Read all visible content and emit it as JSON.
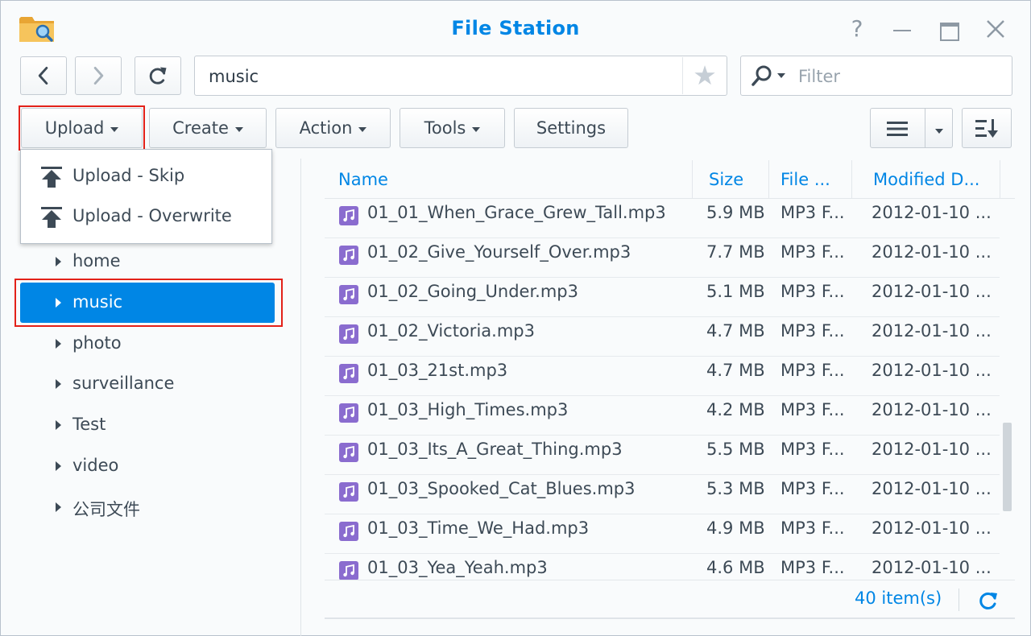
{
  "window": {
    "title": "File Station",
    "help_label": "?",
    "accent_color": "#0086e5",
    "highlight_color": "#e32119"
  },
  "navigation": {
    "path": "music",
    "filter_placeholder": "Filter"
  },
  "toolbar": {
    "upload_label": "Upload",
    "create_label": "Create",
    "action_label": "Action",
    "tools_label": "Tools",
    "settings_label": "Settings"
  },
  "upload_menu": {
    "items": [
      {
        "label": "Upload - Skip",
        "icon": "upload-icon"
      },
      {
        "label": "Upload - Overwrite",
        "icon": "upload-icon"
      }
    ]
  },
  "sidebar": {
    "items": [
      {
        "label": "home",
        "selected": false
      },
      {
        "label": "music",
        "selected": true
      },
      {
        "label": "photo",
        "selected": false
      },
      {
        "label": "surveillance",
        "selected": false
      },
      {
        "label": "Test",
        "selected": false
      },
      {
        "label": "video",
        "selected": false
      },
      {
        "label": "公司文件",
        "selected": false
      }
    ]
  },
  "file_list": {
    "columns": [
      "Name",
      "Size",
      "File ...",
      "Modified D..."
    ],
    "rows": [
      {
        "name": "01_01_When_Grace_Grew_Tall.mp3",
        "size": "5.9 MB",
        "type": "MP3 F...",
        "modified": "2012-01-10 ..."
      },
      {
        "name": "01_02_Give_Yourself_Over.mp3",
        "size": "7.7 MB",
        "type": "MP3 F...",
        "modified": "2012-01-10 ..."
      },
      {
        "name": "01_02_Going_Under.mp3",
        "size": "5.1 MB",
        "type": "MP3 F...",
        "modified": "2012-01-10 ..."
      },
      {
        "name": "01_02_Victoria.mp3",
        "size": "4.7 MB",
        "type": "MP3 F...",
        "modified": "2012-01-10 ..."
      },
      {
        "name": "01_03_21st.mp3",
        "size": "4.7 MB",
        "type": "MP3 F...",
        "modified": "2012-01-10 ..."
      },
      {
        "name": "01_03_High_Times.mp3",
        "size": "4.2 MB",
        "type": "MP3 F...",
        "modified": "2012-01-10 ..."
      },
      {
        "name": "01_03_Its_A_Great_Thing.mp3",
        "size": "5.5 MB",
        "type": "MP3 F...",
        "modified": "2012-01-10 ..."
      },
      {
        "name": "01_03_Spooked_Cat_Blues.mp3",
        "size": "5.3 MB",
        "type": "MP3 F...",
        "modified": "2012-01-10 ..."
      },
      {
        "name": "01_03_Time_We_Had.mp3",
        "size": "4.9 MB",
        "type": "MP3 F...",
        "modified": "2012-01-10 ..."
      },
      {
        "name": "01_03_Yea_Yeah.mp3",
        "size": "4.6 MB",
        "type": "MP3 F...",
        "modified": "2012-01-10 ..."
      }
    ],
    "item_count": "40 item(s)"
  }
}
